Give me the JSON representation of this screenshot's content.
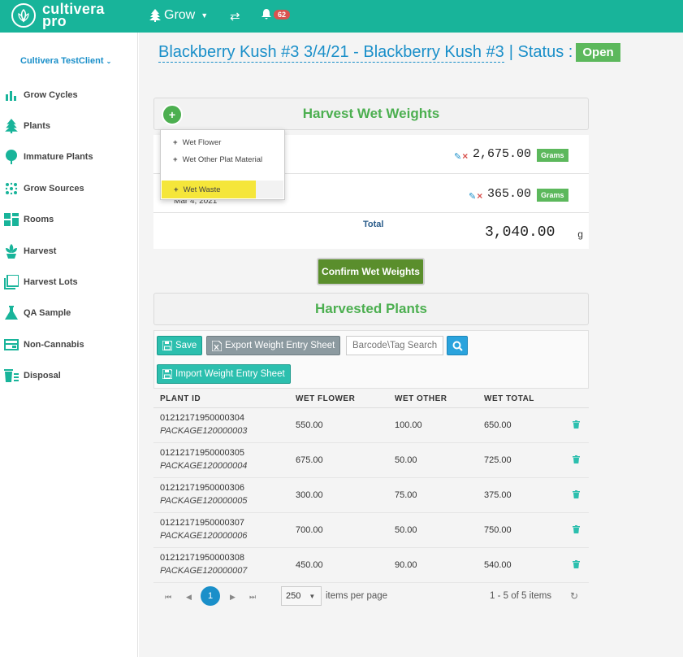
{
  "app": {
    "logo_line1": "cultivera",
    "logo_line2": "pro",
    "nav_grow": "Grow",
    "notifications_count": "62"
  },
  "sidebar": {
    "client": "Cultivera TestClient",
    "items": [
      {
        "label": "Grow Cycles",
        "icon": "bar-chart-icon"
      },
      {
        "label": "Plants",
        "icon": "tree-icon"
      },
      {
        "label": "Immature Plants",
        "icon": "round-tree-icon"
      },
      {
        "label": "Grow Sources",
        "icon": "dots-grid-icon"
      },
      {
        "label": "Rooms",
        "icon": "rooms-icon"
      },
      {
        "label": "Harvest",
        "icon": "harvest-icon"
      },
      {
        "label": "Harvest Lots",
        "icon": "stacked-squares-icon"
      },
      {
        "label": "QA Sample",
        "icon": "flask-icon"
      },
      {
        "label": "Non-Cannabis",
        "icon": "box-icon"
      },
      {
        "label": "Disposal",
        "icon": "trash-list-icon"
      }
    ]
  },
  "header": {
    "title": "Blackberry Kush #3 3/4/21 - Blackberry Kush #3",
    "status_label": "| Status :",
    "status_value": "Open"
  },
  "wet_weights": {
    "heading": "Harvest Wet Weights",
    "rows": [
      {
        "date": "",
        "value": "2,675.00",
        "unit": "Grams"
      },
      {
        "date": "Mar 4, 2021",
        "value": "365.00",
        "unit": "Grams"
      }
    ],
    "total_label": "Total",
    "total_value": "3,040.00",
    "total_unit": "g"
  },
  "add_menu": {
    "items": [
      "Wet Flower",
      "Wet Other Plat Material",
      "Wet Waste"
    ],
    "highlighted": "Wet Waste"
  },
  "confirm_button": "Confirm Wet Weights",
  "harvested": {
    "heading": "Harvested Plants",
    "save_label": "Save",
    "export_label": "Export Weight Entry Sheet",
    "search_placeholder": "Barcode\\Tag Search",
    "import_label": "Import Weight Entry Sheet",
    "columns": [
      "PLANT ID",
      "WET FLOWER",
      "WET OTHER",
      "WET TOTAL"
    ],
    "rows": [
      {
        "plant_id": "01212171950000304",
        "package": "PACKAGE120000003",
        "wet_flower": "550.00",
        "wet_other": "100.00",
        "wet_total": "650.00"
      },
      {
        "plant_id": "01212171950000305",
        "package": "PACKAGE120000004",
        "wet_flower": "675.00",
        "wet_other": "50.00",
        "wet_total": "725.00"
      },
      {
        "plant_id": "01212171950000306",
        "package": "PACKAGE120000005",
        "wet_flower": "300.00",
        "wet_other": "75.00",
        "wet_total": "375.00"
      },
      {
        "plant_id": "01212171950000307",
        "package": "PACKAGE120000006",
        "wet_flower": "700.00",
        "wet_other": "50.00",
        "wet_total": "750.00"
      },
      {
        "plant_id": "01212171950000308",
        "package": "PACKAGE120000007",
        "wet_flower": "450.00",
        "wet_other": "90.00",
        "wet_total": "540.00"
      }
    ]
  },
  "pager": {
    "current_page": "1",
    "page_size": "250",
    "page_size_label": "items per page",
    "info": "1 - 5 of 5 items"
  },
  "colors": {
    "brand": "#18b49a",
    "accent_blue": "#1a8fc9",
    "green": "#4caf50",
    "highlight": "#f5e63a"
  }
}
